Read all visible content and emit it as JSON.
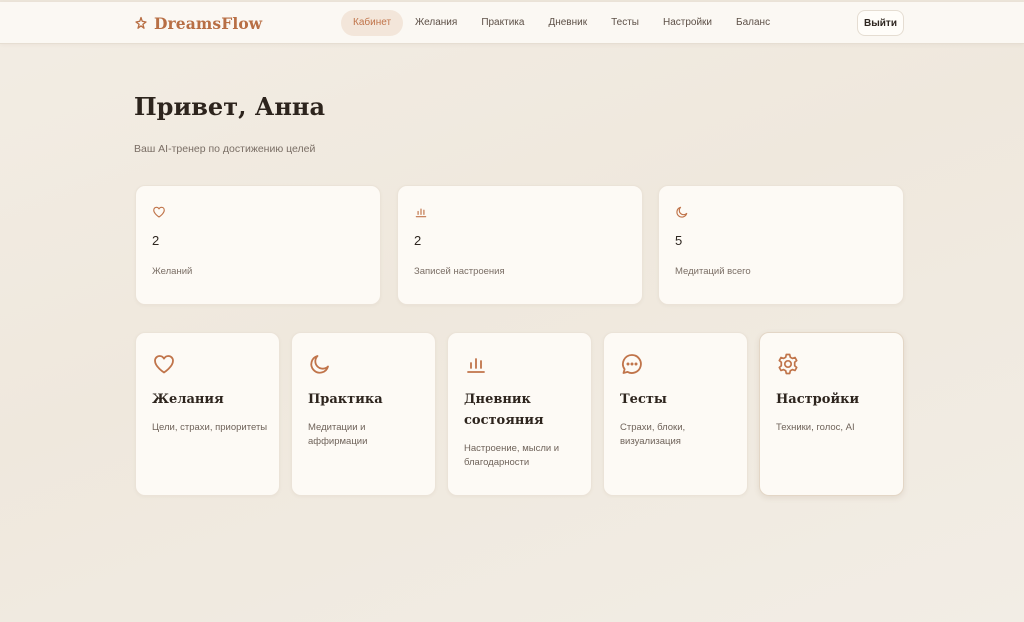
{
  "header": {
    "logo_text": "DreamsFlow",
    "logo_icon": "sparkle-icon",
    "nav": [
      "Кабинет",
      "Желания",
      "Практика",
      "Дневник",
      "Тесты",
      "Настройки",
      "Баланс"
    ],
    "active_nav": "Кабинет",
    "logout_label": "Выйти"
  },
  "main": {
    "greeting": "Привет, Анна",
    "subtitle": "Ваш AI-тренер по достижению целей",
    "stats": [
      {
        "icon": "heart-icon",
        "value": "2",
        "label": "Желаний"
      },
      {
        "icon": "bar-chart-icon",
        "value": "2",
        "label": "Записей настроения"
      },
      {
        "icon": "moon-icon",
        "value": "5",
        "label": "Медитаций всего"
      }
    ],
    "features": [
      {
        "icon": "heart-icon",
        "title": "Желания",
        "desc": "Цели, страхи, приоритеты"
      },
      {
        "icon": "moon-icon",
        "title": "Практика",
        "desc": "Медитации и аффирмации"
      },
      {
        "icon": "bar-chart-icon",
        "title": "Дневник состояния",
        "desc": "Настроение, мысли и благодарности"
      },
      {
        "icon": "chat-bubble-icon",
        "title": "Тесты",
        "desc": "Страхи, блоки, визуализация"
      },
      {
        "icon": "gear-icon",
        "title": "Настройки",
        "desc": "Техники, голос, AI"
      }
    ]
  },
  "colors": {
    "accent": "#c0744a",
    "background": "#f1ebe2",
    "card": "#fdfaf5",
    "text": "#2d241d"
  }
}
